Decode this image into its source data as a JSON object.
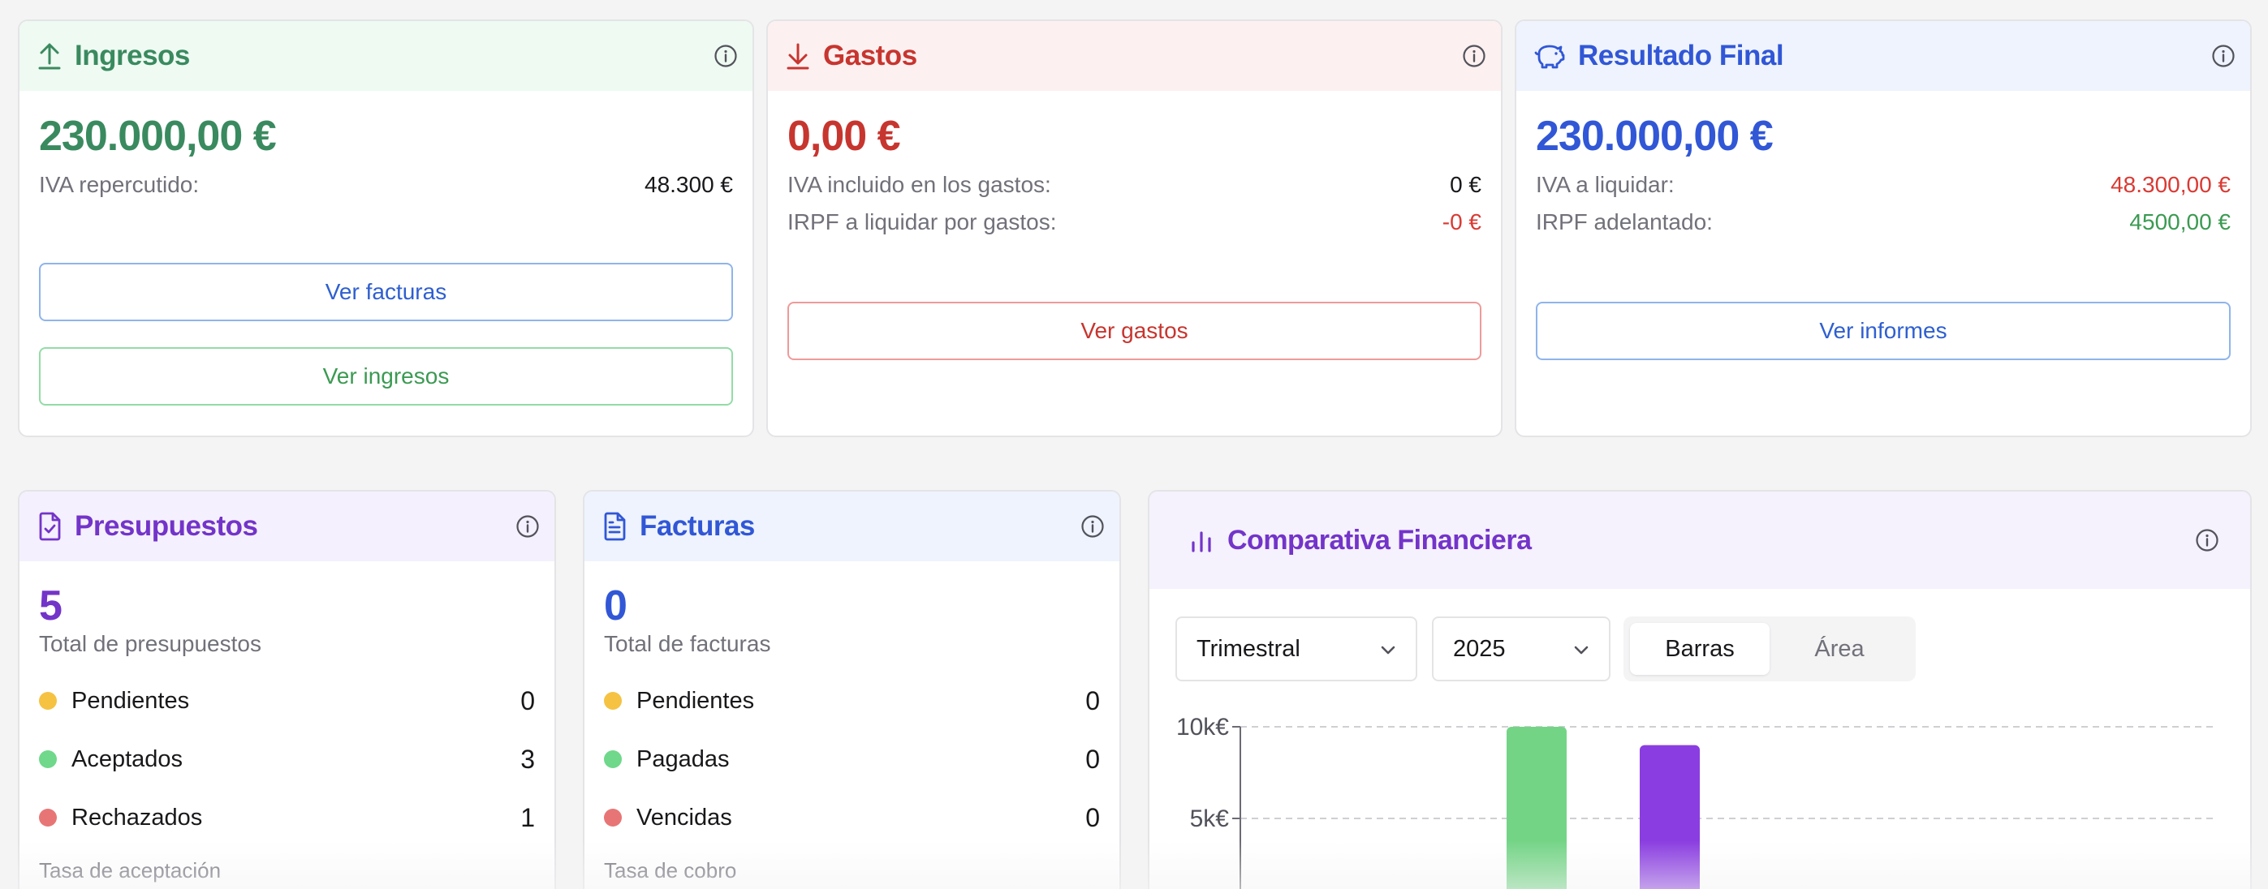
{
  "ingresos": {
    "title": "Ingresos",
    "amount": "230.000,00 €",
    "iva_label": "IVA repercutido:",
    "iva_value": "48.300 €",
    "btn_facturas": "Ver facturas",
    "btn_ingresos": "Ver ingresos"
  },
  "gastos": {
    "title": "Gastos",
    "amount": "0,00 €",
    "iva_label": "IVA incluido en los gastos:",
    "iva_value": "0 €",
    "irpf_label": "IRPF a liquidar por gastos:",
    "irpf_value": "-0 €",
    "btn_gastos": "Ver gastos"
  },
  "resultado": {
    "title": "Resultado Final",
    "amount": "230.000,00 €",
    "iva_label": "IVA a liquidar:",
    "iva_value": "48.300,00 €",
    "irpf_label": "IRPF adelantado:",
    "irpf_value": "4500,00 €",
    "btn_informes": "Ver informes"
  },
  "presupuestos": {
    "title": "Presupuestos",
    "count": "5",
    "subtitle": "Total de presupuestos",
    "items": [
      {
        "label": "Pendientes",
        "value": "0",
        "color": "#f5c242"
      },
      {
        "label": "Aceptados",
        "value": "3",
        "color": "#6fd88a"
      },
      {
        "label": "Rechazados",
        "value": "1",
        "color": "#e87575"
      }
    ],
    "footer": "Tasa de aceptación"
  },
  "facturas": {
    "title": "Facturas",
    "count": "0",
    "subtitle": "Total de facturas",
    "items": [
      {
        "label": "Pendientes",
        "value": "0",
        "color": "#f5c242"
      },
      {
        "label": "Pagadas",
        "value": "0",
        "color": "#6fd88a"
      },
      {
        "label": "Vencidas",
        "value": "0",
        "color": "#e87575"
      }
    ],
    "footer": "Tasa de cobro"
  },
  "comparativa": {
    "title": "Comparativa Financiera",
    "period_select": "Trimestral",
    "year_select": "2025",
    "toggle_bars": "Barras",
    "toggle_area": "Área"
  },
  "colors": {
    "green": "#3a8a5f",
    "red": "#c7352f",
    "blue": "#3157d6",
    "purple": "#7334c9"
  },
  "chart_data": {
    "type": "bar",
    "y_ticks": [
      "10k€",
      "5k€"
    ],
    "ylim": [
      0,
      10000
    ],
    "series": [
      {
        "values": [
          10000
        ],
        "color": "#74d486"
      },
      {
        "values": [
          9000
        ],
        "color": "#8a3de0"
      }
    ]
  }
}
